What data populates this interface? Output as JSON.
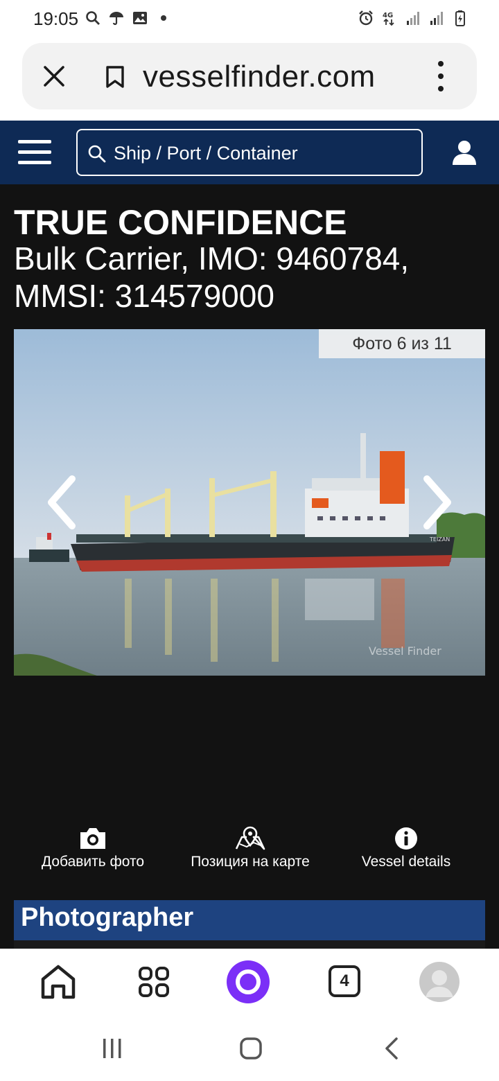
{
  "status_bar": {
    "time": "19:05",
    "icons_left": [
      "search-icon",
      "umbrella-icon",
      "image-icon",
      "dot-icon"
    ],
    "icons_right": [
      "alarm-icon",
      "4g-icon",
      "signal-icon",
      "signal-icon",
      "battery-charging-icon"
    ]
  },
  "browser": {
    "url": "vesselfinder.com",
    "icons": [
      "close-icon",
      "bookmark-icon",
      "more-vert-icon"
    ]
  },
  "site_header": {
    "search_placeholder": "Ship / Port / Container",
    "icons": [
      "menu-icon",
      "search-icon",
      "user-icon"
    ]
  },
  "vessel": {
    "name": "TRUE CONFIDENCE",
    "subtitle": "Bulk Carrier, IMO: 9460784, MMSI: 314579000"
  },
  "photo": {
    "counter": "Фото 6 из 11",
    "watermark": "Vessel Finder",
    "hull_text": "TEIZAN"
  },
  "actions": [
    {
      "label": "Добавить фото",
      "icon": "camera-icon"
    },
    {
      "label": "Позиция на карте",
      "icon": "map-pin-icon"
    },
    {
      "label": "Vessel details",
      "icon": "info-icon"
    }
  ],
  "photographer": {
    "heading": "Photographer"
  },
  "bottom_nav": {
    "tabs_count": "4",
    "icons": [
      "home-icon",
      "apps-icon",
      "alice-icon",
      "tabs-icon",
      "avatar"
    ]
  },
  "colors": {
    "header_bg": "#0e2a55",
    "page_bg": "#121212",
    "photographer_bg": "#1e4380",
    "alice_purple": "#7b2ff7"
  }
}
